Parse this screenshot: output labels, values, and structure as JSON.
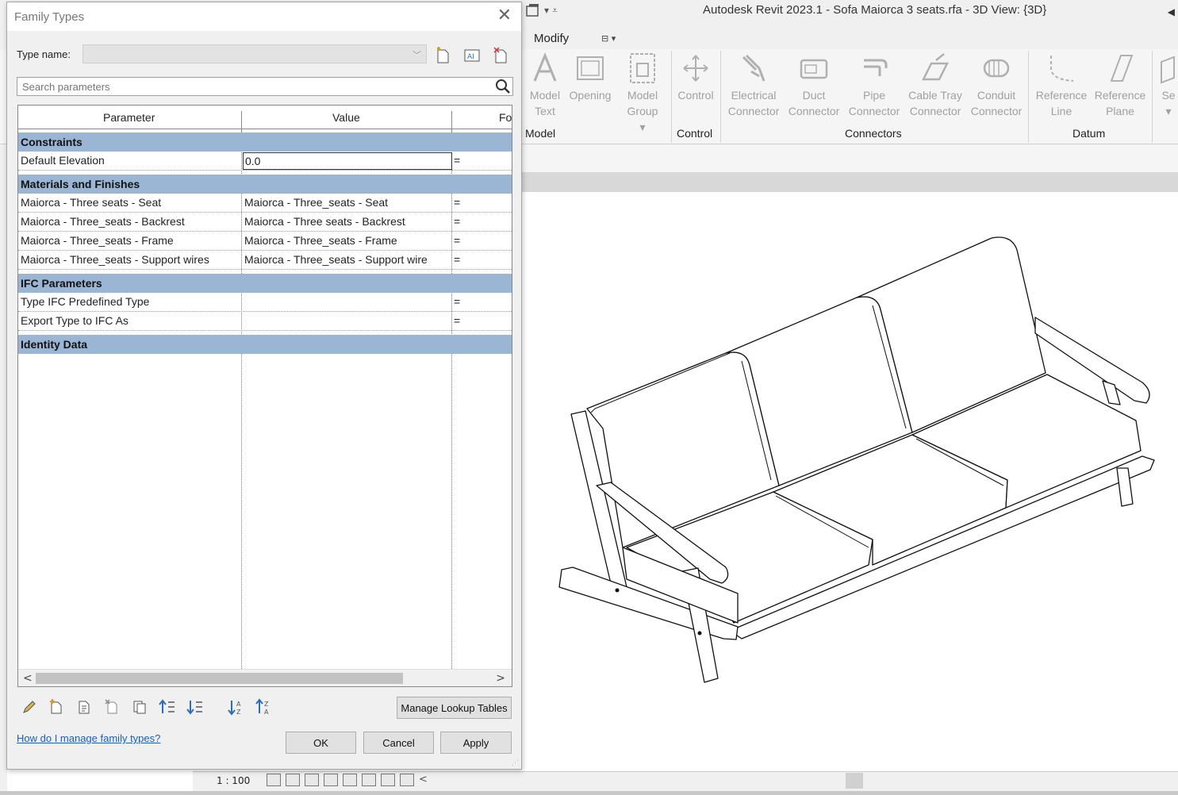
{
  "app": {
    "title": "Autodesk Revit 2023.1 - Sofa Maiorca 3 seats.rfa - 3D View: {3D}",
    "active_tab": "Modify"
  },
  "ribbon": {
    "tools": [
      {
        "label": "Model\nText",
        "icon": "model-text-icon"
      },
      {
        "label": "Opening",
        "icon": "opening-icon"
      },
      {
        "label": "Model\nGroup",
        "icon": "model-group-icon"
      },
      {
        "label": "Control",
        "icon": "control-icon"
      },
      {
        "label": "Electrical\nConnector",
        "icon": "electrical-connector-icon"
      },
      {
        "label": "Duct\nConnector",
        "icon": "duct-connector-icon"
      },
      {
        "label": "Pipe\nConnector",
        "icon": "pipe-connector-icon"
      },
      {
        "label": "Cable Tray\nConnector",
        "icon": "cable-tray-connector-icon"
      },
      {
        "label": "Conduit\nConnector",
        "icon": "conduit-connector-icon"
      },
      {
        "label": "Reference\nLine",
        "icon": "reference-line-icon"
      },
      {
        "label": "Reference\nPlane",
        "icon": "reference-plane-icon"
      },
      {
        "label": "Se",
        "icon": "set-icon"
      }
    ],
    "panels": [
      "Model",
      "Control",
      "Connectors",
      "Datum"
    ]
  },
  "statusbar": {
    "scale": "1 : 100"
  },
  "dialog": {
    "title": "Family Types",
    "type_name_label": "Type name:",
    "type_name_value": "",
    "search_placeholder": "Search parameters",
    "columns": [
      "Parameter",
      "Value",
      "Fo"
    ],
    "groups": {
      "constraints": "Constraints",
      "materials": "Materials and Finishes",
      "ifc": "IFC Parameters",
      "identity": "Identity Data"
    },
    "rows": {
      "default_elevation": {
        "name": "Default Elevation",
        "value": "0.0",
        "formula": "="
      },
      "mat_seat": {
        "name": "Maiorca - Three seats - Seat",
        "value": "Maiorca - Three_seats - Seat",
        "formula": "="
      },
      "mat_backrest": {
        "name": "Maiorca - Three_seats - Backrest",
        "value": "Maiorca - Three seats - Backrest",
        "formula": "="
      },
      "mat_frame": {
        "name": "Maiorca - Three_seats - Frame",
        "value": "Maiorca - Three_seats - Frame",
        "formula": "="
      },
      "mat_wires": {
        "name": "Maiorca - Three_seats - Support wires",
        "value": "Maiorca - Three_seats - Support wire",
        "formula": "="
      },
      "ifc_type": {
        "name": "Type IFC Predefined Type",
        "value": "",
        "formula": "="
      },
      "ifc_export": {
        "name": "Export Type to IFC As",
        "value": "",
        "formula": "="
      }
    },
    "manage_lookup_label": "Manage Lookup Tables",
    "help_link": "How do I manage family types?",
    "ok_label": "OK",
    "cancel_label": "Cancel",
    "apply_label": "Apply"
  }
}
